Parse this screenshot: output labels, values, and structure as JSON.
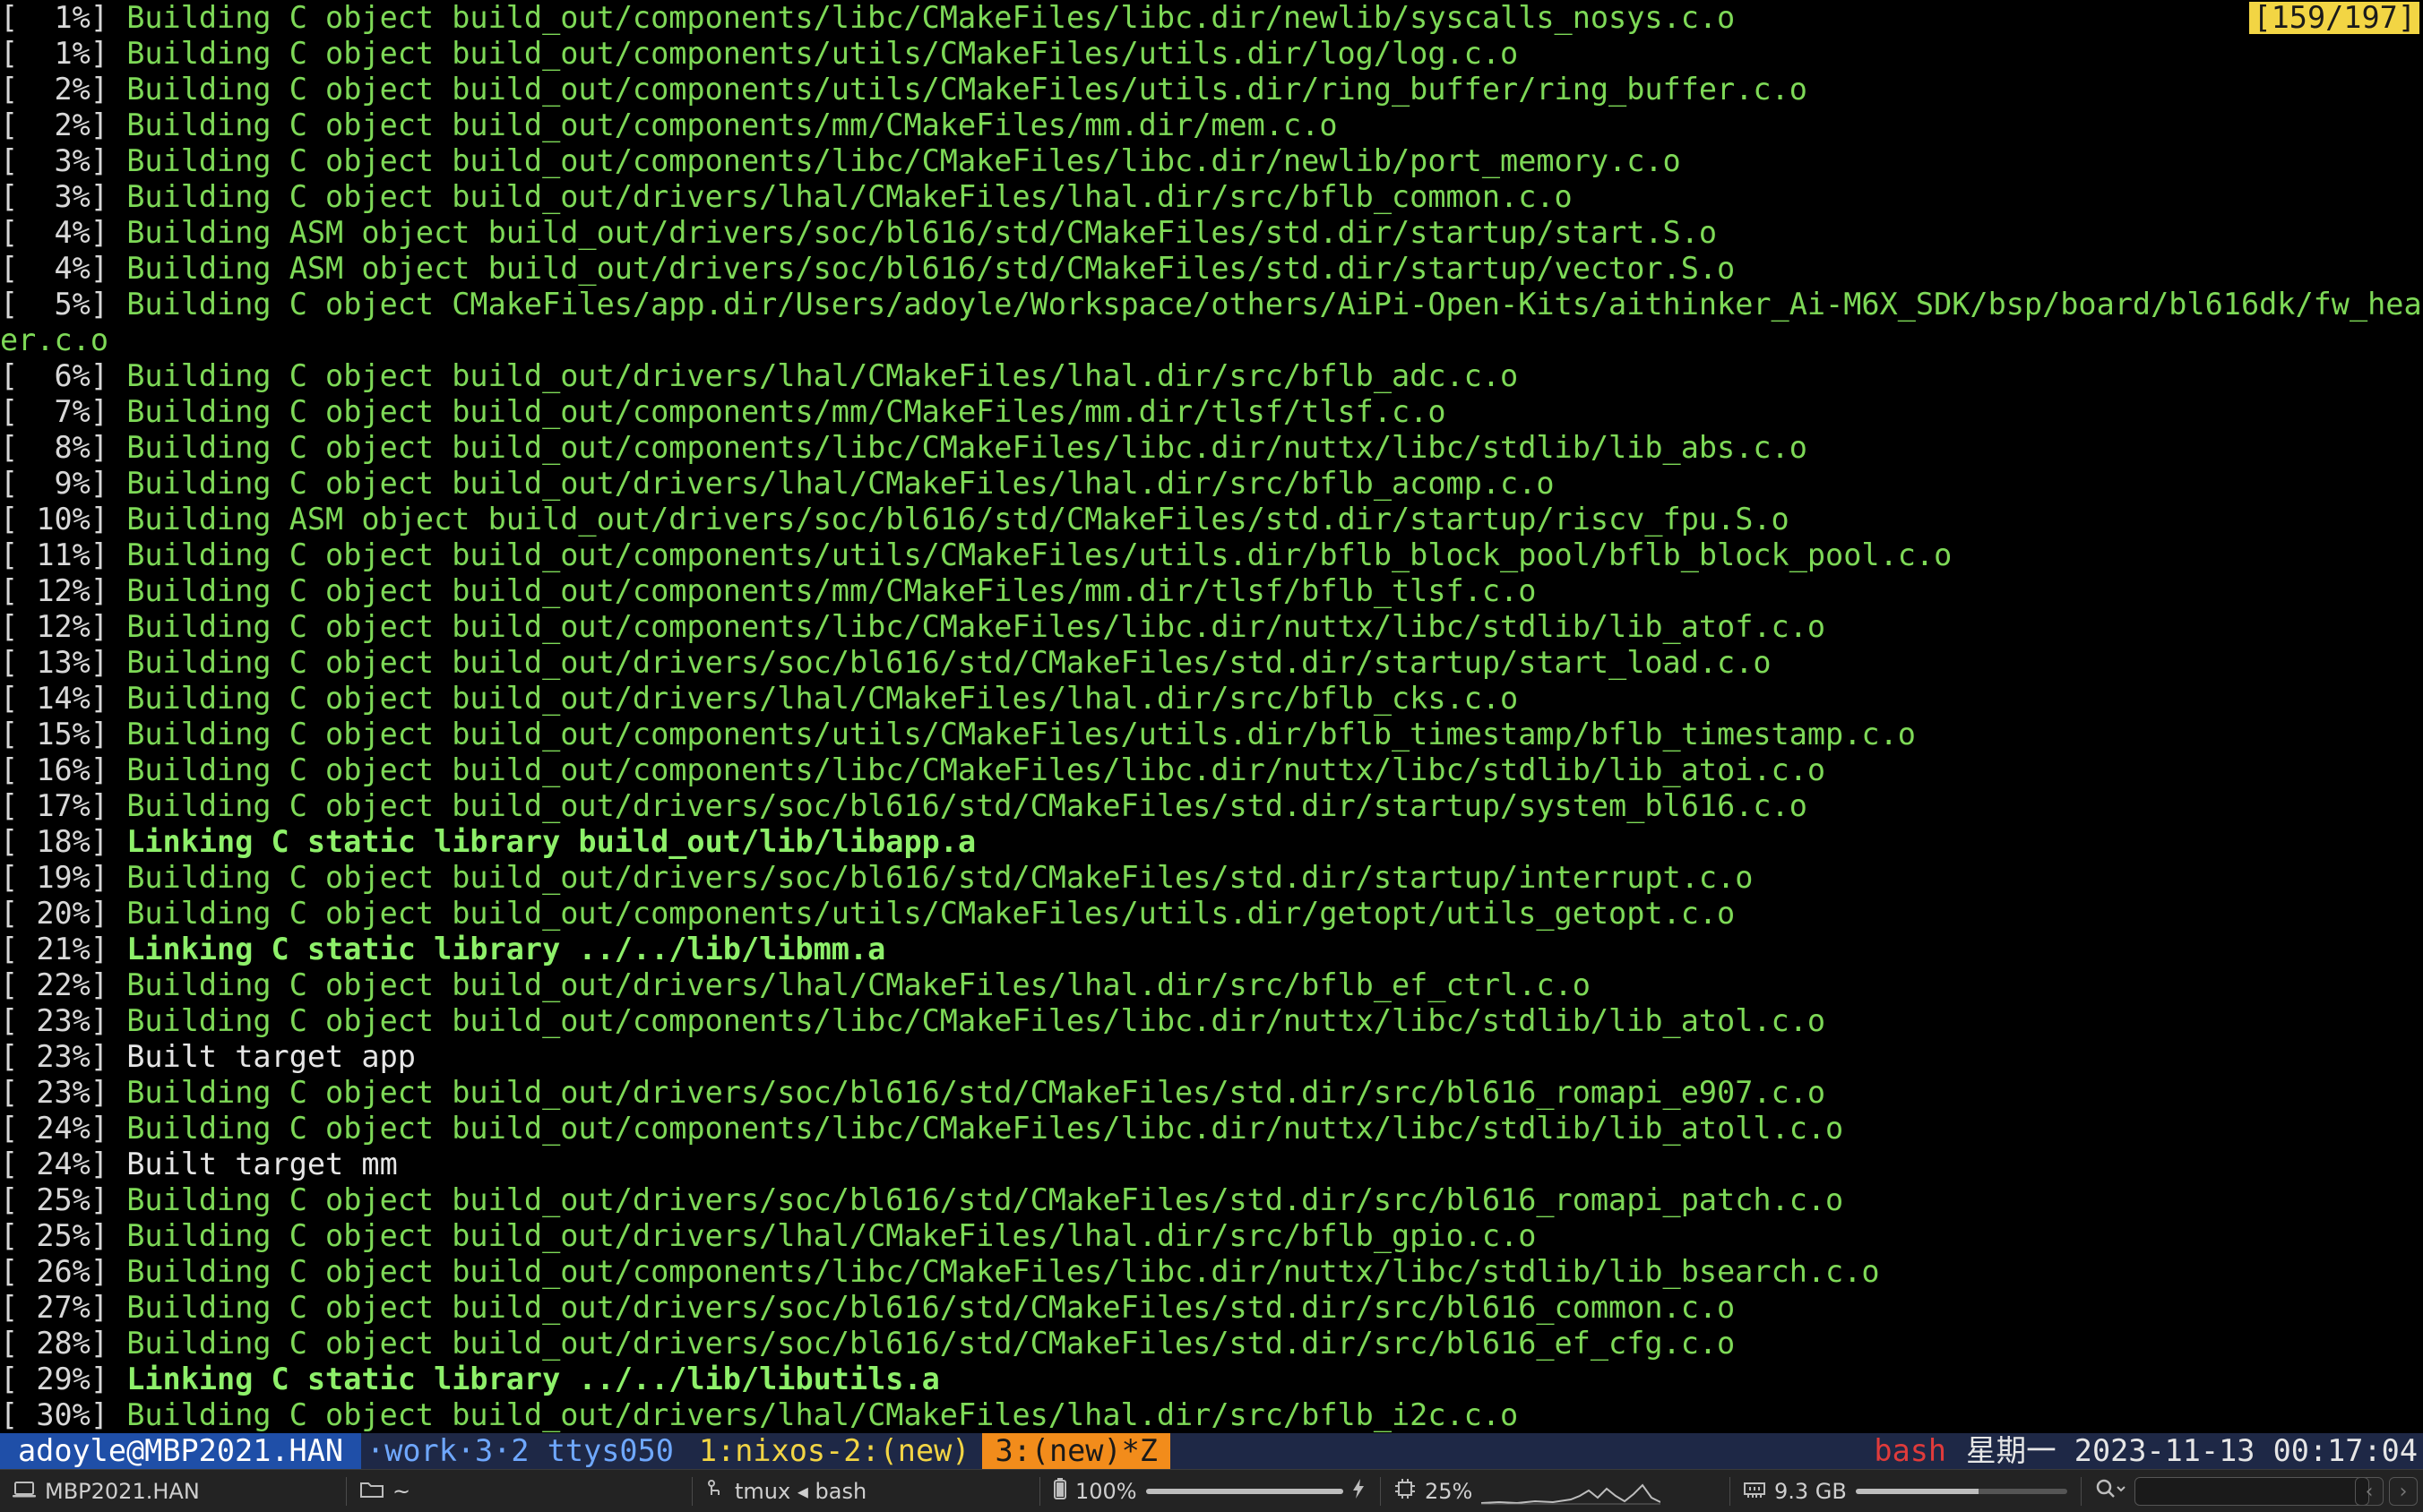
{
  "build_counter": "[159/197]",
  "lines": [
    {
      "pct": "  1%",
      "type": "build",
      "text": "Building C object build_out/components/libc/CMakeFiles/libc.dir/newlib/syscalls_nosys.c.o"
    },
    {
      "pct": "  1%",
      "type": "build",
      "text": "Building C object build_out/components/utils/CMakeFiles/utils.dir/log/log.c.o"
    },
    {
      "pct": "  2%",
      "type": "build",
      "text": "Building C object build_out/components/utils/CMakeFiles/utils.dir/ring_buffer/ring_buffer.c.o"
    },
    {
      "pct": "  2%",
      "type": "build",
      "text": "Building C object build_out/components/mm/CMakeFiles/mm.dir/mem.c.o"
    },
    {
      "pct": "  3%",
      "type": "build",
      "text": "Building C object build_out/components/libc/CMakeFiles/libc.dir/newlib/port_memory.c.o"
    },
    {
      "pct": "  3%",
      "type": "build",
      "text": "Building C object build_out/drivers/lhal/CMakeFiles/lhal.dir/src/bflb_common.c.o"
    },
    {
      "pct": "  4%",
      "type": "build",
      "text": "Building ASM object build_out/drivers/soc/bl616/std/CMakeFiles/std.dir/startup/start.S.o"
    },
    {
      "pct": "  4%",
      "type": "build",
      "text": "Building ASM object build_out/drivers/soc/bl616/std/CMakeFiles/std.dir/startup/vector.S.o"
    },
    {
      "pct": "  5%",
      "type": "build",
      "text": "Building C object CMakeFiles/app.dir/Users/adoyle/Workspace/others/AiPi-Open-Kits/aithinker_Ai-M6X_SDK/bsp/board/bl616dk/fw_head",
      "wrap": "er.c.o"
    },
    {
      "pct": "  6%",
      "type": "build",
      "text": "Building C object build_out/drivers/lhal/CMakeFiles/lhal.dir/src/bflb_adc.c.o"
    },
    {
      "pct": "  7%",
      "type": "build",
      "text": "Building C object build_out/components/mm/CMakeFiles/mm.dir/tlsf/tlsf.c.o"
    },
    {
      "pct": "  8%",
      "type": "build",
      "text": "Building C object build_out/components/libc/CMakeFiles/libc.dir/nuttx/libc/stdlib/lib_abs.c.o"
    },
    {
      "pct": "  9%",
      "type": "build",
      "text": "Building C object build_out/drivers/lhal/CMakeFiles/lhal.dir/src/bflb_acomp.c.o"
    },
    {
      "pct": " 10%",
      "type": "build",
      "text": "Building ASM object build_out/drivers/soc/bl616/std/CMakeFiles/std.dir/startup/riscv_fpu.S.o"
    },
    {
      "pct": " 11%",
      "type": "build",
      "text": "Building C object build_out/components/utils/CMakeFiles/utils.dir/bflb_block_pool/bflb_block_pool.c.o"
    },
    {
      "pct": " 12%",
      "type": "build",
      "text": "Building C object build_out/components/mm/CMakeFiles/mm.dir/tlsf/bflb_tlsf.c.o"
    },
    {
      "pct": " 12%",
      "type": "build",
      "text": "Building C object build_out/components/libc/CMakeFiles/libc.dir/nuttx/libc/stdlib/lib_atof.c.o"
    },
    {
      "pct": " 13%",
      "type": "build",
      "text": "Building C object build_out/drivers/soc/bl616/std/CMakeFiles/std.dir/startup/start_load.c.o"
    },
    {
      "pct": " 14%",
      "type": "build",
      "text": "Building C object build_out/drivers/lhal/CMakeFiles/lhal.dir/src/bflb_cks.c.o"
    },
    {
      "pct": " 15%",
      "type": "build",
      "text": "Building C object build_out/components/utils/CMakeFiles/utils.dir/bflb_timestamp/bflb_timestamp.c.o"
    },
    {
      "pct": " 16%",
      "type": "build",
      "text": "Building C object build_out/components/libc/CMakeFiles/libc.dir/nuttx/libc/stdlib/lib_atoi.c.o"
    },
    {
      "pct": " 17%",
      "type": "build",
      "text": "Building C object build_out/drivers/soc/bl616/std/CMakeFiles/std.dir/startup/system_bl616.c.o"
    },
    {
      "pct": " 18%",
      "type": "link",
      "text": "Linking C static library build_out/lib/libapp.a"
    },
    {
      "pct": " 19%",
      "type": "build",
      "text": "Building C object build_out/drivers/soc/bl616/std/CMakeFiles/std.dir/startup/interrupt.c.o"
    },
    {
      "pct": " 20%",
      "type": "build",
      "text": "Building C object build_out/components/utils/CMakeFiles/utils.dir/getopt/utils_getopt.c.o"
    },
    {
      "pct": " 21%",
      "type": "link",
      "text": "Linking C static library ../../lib/libmm.a"
    },
    {
      "pct": " 22%",
      "type": "build",
      "text": "Building C object build_out/drivers/lhal/CMakeFiles/lhal.dir/src/bflb_ef_ctrl.c.o"
    },
    {
      "pct": " 23%",
      "type": "build",
      "text": "Building C object build_out/components/libc/CMakeFiles/libc.dir/nuttx/libc/stdlib/lib_atol.c.o"
    },
    {
      "pct": " 23%",
      "type": "built",
      "text": "Built target app"
    },
    {
      "pct": " 23%",
      "type": "build",
      "text": "Building C object build_out/drivers/soc/bl616/std/CMakeFiles/std.dir/src/bl616_romapi_e907.c.o"
    },
    {
      "pct": " 24%",
      "type": "build",
      "text": "Building C object build_out/components/libc/CMakeFiles/libc.dir/nuttx/libc/stdlib/lib_atoll.c.o"
    },
    {
      "pct": " 24%",
      "type": "built",
      "text": "Built target mm"
    },
    {
      "pct": " 25%",
      "type": "build",
      "text": "Building C object build_out/drivers/soc/bl616/std/CMakeFiles/std.dir/src/bl616_romapi_patch.c.o"
    },
    {
      "pct": " 25%",
      "type": "build",
      "text": "Building C object build_out/drivers/lhal/CMakeFiles/lhal.dir/src/bflb_gpio.c.o"
    },
    {
      "pct": " 26%",
      "type": "build",
      "text": "Building C object build_out/components/libc/CMakeFiles/libc.dir/nuttx/libc/stdlib/lib_bsearch.c.o"
    },
    {
      "pct": " 27%",
      "type": "build",
      "text": "Building C object build_out/drivers/soc/bl616/std/CMakeFiles/std.dir/src/bl616_common.c.o"
    },
    {
      "pct": " 28%",
      "type": "build",
      "text": "Building C object build_out/drivers/soc/bl616/std/CMakeFiles/std.dir/src/bl616_ef_cfg.c.o"
    },
    {
      "pct": " 29%",
      "type": "link",
      "text": "Linking C static library ../../lib/libutils.a"
    },
    {
      "pct": " 30%",
      "type": "build",
      "text": "Building C object build_out/drivers/lhal/CMakeFiles/lhal.dir/src/bflb_i2c.c.o"
    }
  ],
  "tmux": {
    "session": "adoyle@MBP2021.HAN",
    "session_info": "·work·3·2 ttys050",
    "window_1": "1:nixos-2:(new)",
    "window_active": "3:(new)*Z",
    "shell": "bash",
    "weekday": "星期一",
    "datetime": "2023-11-13 00:17:04"
  },
  "statusbar": {
    "host": "MBP2021.HAN",
    "directory": "~",
    "process": "tmux ◂ bash",
    "battery_label": "100%",
    "battery_level": 1.0,
    "cpu_label": "25%",
    "cpu_level": 0.25,
    "memory_label": "9.3 GB",
    "memory_level": 0.58,
    "icons": [
      "computer-icon",
      "folder-icon",
      "process-icon",
      "battery-icon",
      "bolt-icon",
      "cpu-icon",
      "memory-icon",
      "search-icon",
      "back-icon",
      "forward-icon"
    ]
  }
}
